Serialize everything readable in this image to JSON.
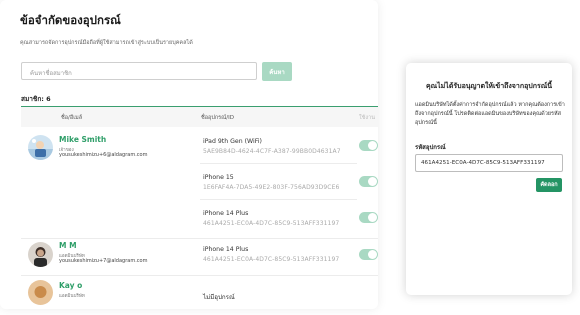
{
  "header": {
    "title": "ข้อจำกัดของอุปกรณ์",
    "subtitle": "คุณสามารถจัดการอุปกรณ์มือถือที่ผู้ใช้สามารถเข้าสู่ระบบเป็นรายบุคคลได้"
  },
  "search": {
    "placeholder": "ค้นหาชื่อสมาชิก",
    "button_label": "ค้นหา"
  },
  "member_count_label": "สมาชิก: 6",
  "table": {
    "columns": [
      "ชื่อ/อีเมล์",
      "ชื่ออุปกรณ์/ID",
      "ใช้งาน"
    ]
  },
  "users": [
    {
      "name": "Mike Smith",
      "role": "เจ้าของ",
      "email": "yousukeshimizu+6@aldagram.com",
      "devices": [
        {
          "name": "iPad 9th Gen (WiFi)",
          "id": "5AE9B84D-4624-4C7F-A387-99BB0D4631A7",
          "enabled": true
        },
        {
          "name": "iPhone 15",
          "id": "1E6FAF4A-7DA5-49E2-803F-756AD93D9CE6",
          "enabled": true
        },
        {
          "name": "iPhone 14 Plus",
          "id": "461A4251-EC0A-4D7C-85C9-513AFF331197",
          "enabled": true
        }
      ]
    },
    {
      "name": "M M",
      "role": "แอดมินบริษัท",
      "email": "yousukeshimizu+7@aldagram.com",
      "devices": [
        {
          "name": "iPhone 14 Plus",
          "id": "461A4251-EC0A-4D7C-85C9-513AFF331197",
          "enabled": true
        }
      ]
    },
    {
      "name": "Kay o",
      "role": "แอดมินบริษัท",
      "email": "",
      "devices": [
        {
          "name": "ไม่มีอุปกรณ์",
          "id": "",
          "enabled": false
        }
      ]
    }
  ],
  "modal": {
    "title": "คุณไม่ได้รับอนุญาตให้เข้าถึงจากอุปกรณ์นี้",
    "body": "แอดมินบริษัทได้ตั้งค่าการจำกัดอุปกรณ์แล้ว หากคุณต้องการเข้าถึงจากอุปกรณ์นี้ โปรดติดต่อแอดมินของบริษัทของคุณด้วยรหัสอุปกรณ์นี้",
    "device_code_label": "รหัสอุปกรณ์",
    "device_code_value": "461A4251-EC0A-4D7C-85C9-513AFF331197",
    "copy_button_label": "คัดลอก"
  },
  "colors": {
    "accent": "#249464",
    "accent_light": "#a9d9c3",
    "name_green": "#2e9e68"
  }
}
